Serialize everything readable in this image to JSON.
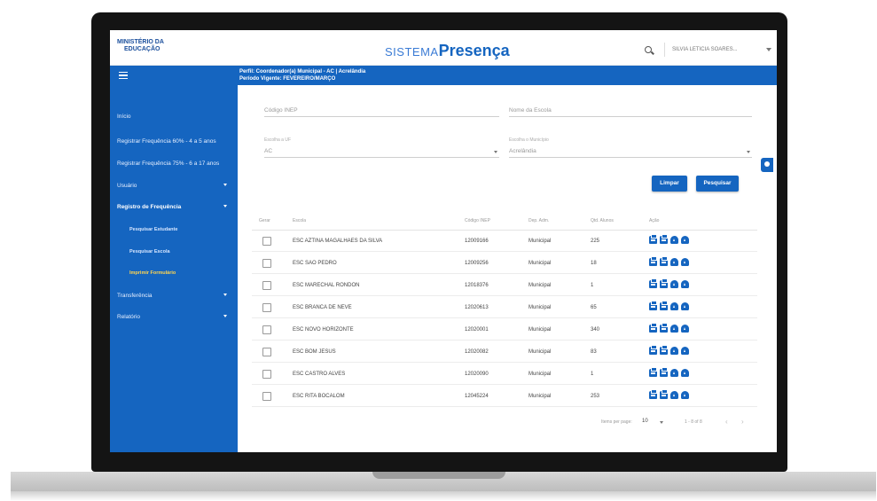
{
  "header": {
    "logo_line1": "MINISTÉRIO DA",
    "logo_line2": "EDUCAÇÃO",
    "brand_part1": "SISTEMA",
    "brand_part2": "Presença",
    "user": "SILVIA LETICIA SOARES...",
    "icons": [
      "search-icon",
      "chevron-down-icon"
    ]
  },
  "topbar": {
    "profile_line1": "Perfil: Coordenador(a) Municipal - AC | Acrelândia",
    "profile_line2": "Período Vigente: FEVEREIRO/MARÇO"
  },
  "sidebar": {
    "items": [
      {
        "label": "Início"
      },
      {
        "label": "Registrar Frequência 60% - 4 a 5 anos"
      },
      {
        "label": "Registrar Frequência 75% - 6 a 17 anos"
      },
      {
        "label": "Usuário"
      },
      {
        "label": "Registro de Frequência"
      },
      {
        "label": "Pesquisar Estudante"
      },
      {
        "label": "Pesquisar Escola"
      },
      {
        "label": "Imprimir Formulário"
      },
      {
        "label": "Transferência"
      },
      {
        "label": "Relatório"
      }
    ]
  },
  "filters": {
    "inep_placeholder": "Código INEP",
    "school_name_placeholder": "Nome da Escola",
    "uf_label": "Escolha a UF",
    "uf_value": "AC",
    "municipio_label": "Escolha o Município",
    "municipio_value": "Acrelândia",
    "clear_label": "Limpar",
    "search_label": "Pesquisar"
  },
  "table": {
    "headers": [
      "Gerar",
      "Escola",
      "Código INEP",
      "Dep. Adm.",
      "Qtd. Alunos",
      "Ação"
    ],
    "rows": [
      {
        "escola": "ESC AZTINA MAGALHAES DA SILVA",
        "inep": "12009166",
        "dep": "Municipal",
        "qtd": "225"
      },
      {
        "escola": "ESC SAO PEDRO",
        "inep": "12009256",
        "dep": "Municipal",
        "qtd": "18"
      },
      {
        "escola": "ESC MARECHAL RONDON",
        "inep": "12018376",
        "dep": "Municipal",
        "qtd": "1"
      },
      {
        "escola": "ESC BRANCA DE NEVE",
        "inep": "12020613",
        "dep": "Municipal",
        "qtd": "65"
      },
      {
        "escola": "ESC NOVO HORIZONTE",
        "inep": "12020001",
        "dep": "Municipal",
        "qtd": "340"
      },
      {
        "escola": "ESC BOM JESUS",
        "inep": "12020082",
        "dep": "Municipal",
        "qtd": "83"
      },
      {
        "escola": "ESC CASTRO ALVES",
        "inep": "12020090",
        "dep": "Municipal",
        "qtd": "1"
      },
      {
        "escola": "ESC RITA BOCALOM",
        "inep": "12045224",
        "dep": "Municipal",
        "qtd": "253"
      }
    ],
    "action_icons": [
      "print-icon",
      "print-icon",
      "cloud-upload-icon",
      "cloud-upload-icon"
    ]
  },
  "pager": {
    "items_per_page_label": "Items per page:",
    "items_per_page_value": "10",
    "range": "1 - 8 of 8"
  },
  "colors": {
    "primary": "#1565c0",
    "highlight": "#ffd54f"
  }
}
